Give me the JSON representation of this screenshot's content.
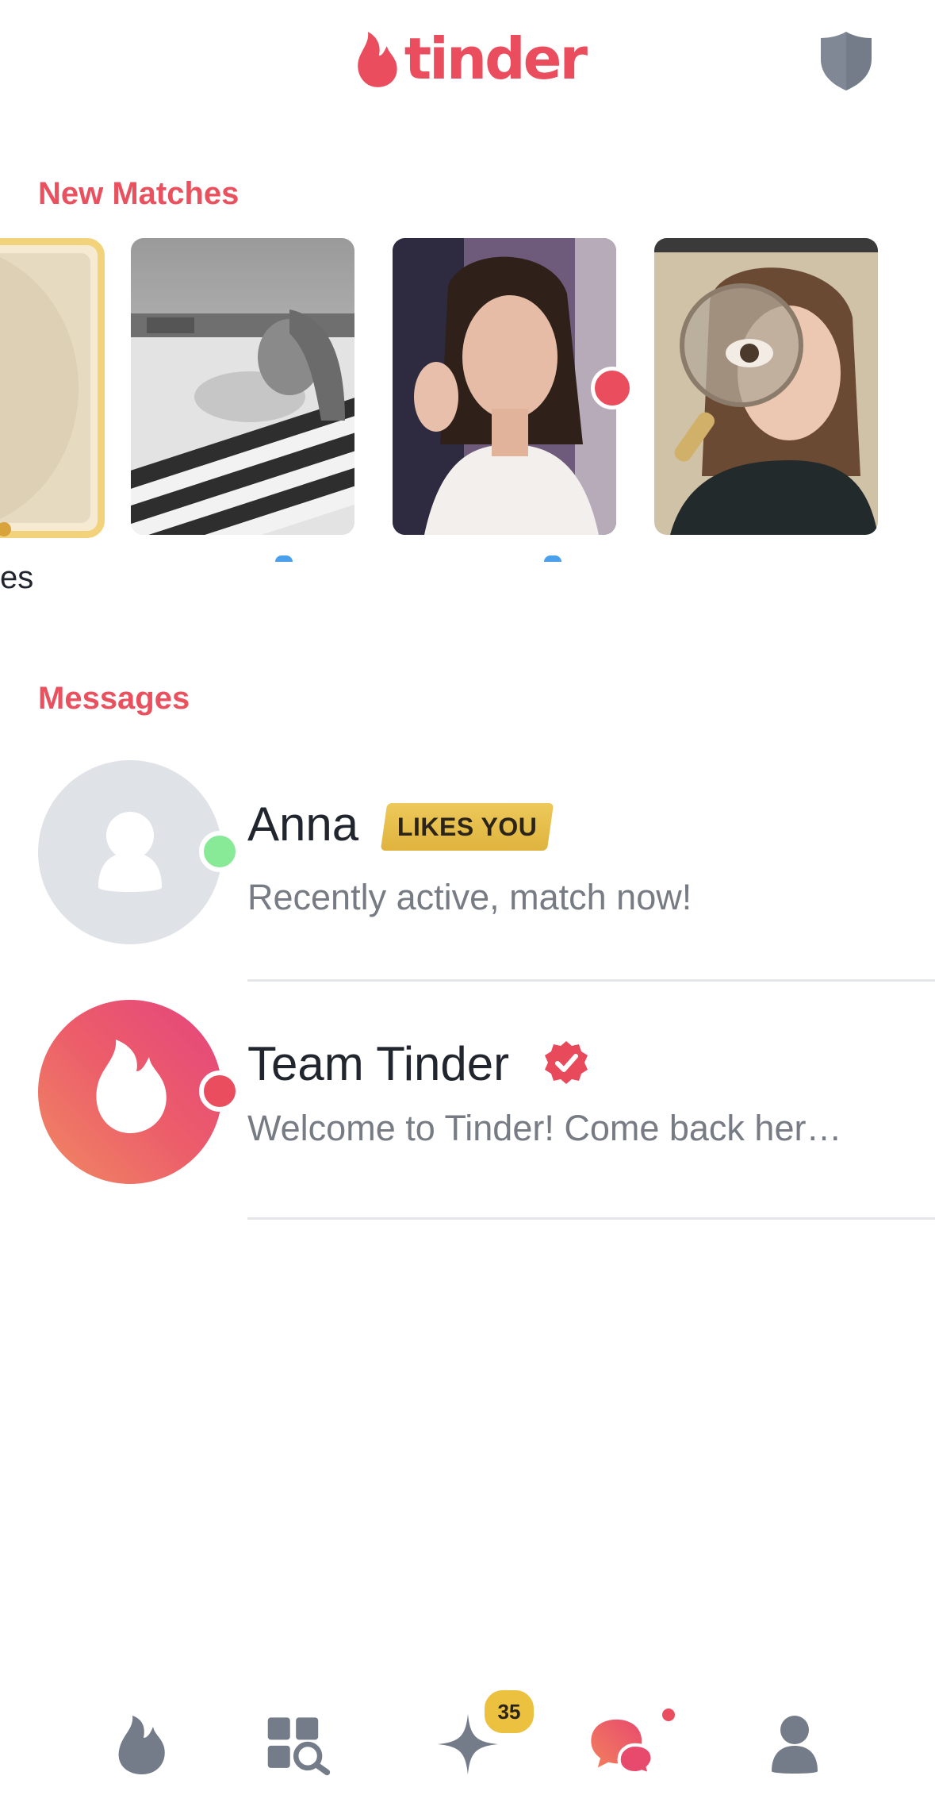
{
  "header": {
    "logo_text": "tinder",
    "logo_icon": "tinder-flame-icon",
    "safety_icon": "shield-icon"
  },
  "new_matches": {
    "title": "New Matches",
    "likes_tile_label": "es",
    "matches": [
      {
        "name": "",
        "photo": "woman lying on striped beach towel (black and white)"
      },
      {
        "name": "",
        "photo": "woman with dark hair touching earring"
      },
      {
        "name": "",
        "photo": "woman holding magnifying glass over eye"
      }
    ]
  },
  "messages": {
    "title": "Messages",
    "items": [
      {
        "name": "Anna",
        "badge": "LIKES YOU",
        "preview": "Recently active, match now!",
        "avatar_icon": "person-silhouette-icon",
        "status": "online"
      },
      {
        "name": "Team Tinder",
        "preview": "Welcome to Tinder! Come back her…",
        "avatar_icon": "tinder-flame-icon",
        "verified_icon": "verified-badge-icon",
        "status": "unread"
      }
    ]
  },
  "tabbar": {
    "items": [
      {
        "name": "Swipe",
        "icon": "flame-icon"
      },
      {
        "name": "Explore",
        "icon": "explore-icon"
      },
      {
        "name": "Gold",
        "icon": "sparkle-icon",
        "badge": "35"
      },
      {
        "name": "Chat",
        "icon": "chat-bubbles-icon",
        "active": true
      },
      {
        "name": "Profile",
        "icon": "person-icon"
      }
    ]
  },
  "colors": {
    "brand": "#ea4d5d",
    "gold": "#edc140",
    "online": "#88ea97",
    "icon_gray": "#7c8591"
  }
}
